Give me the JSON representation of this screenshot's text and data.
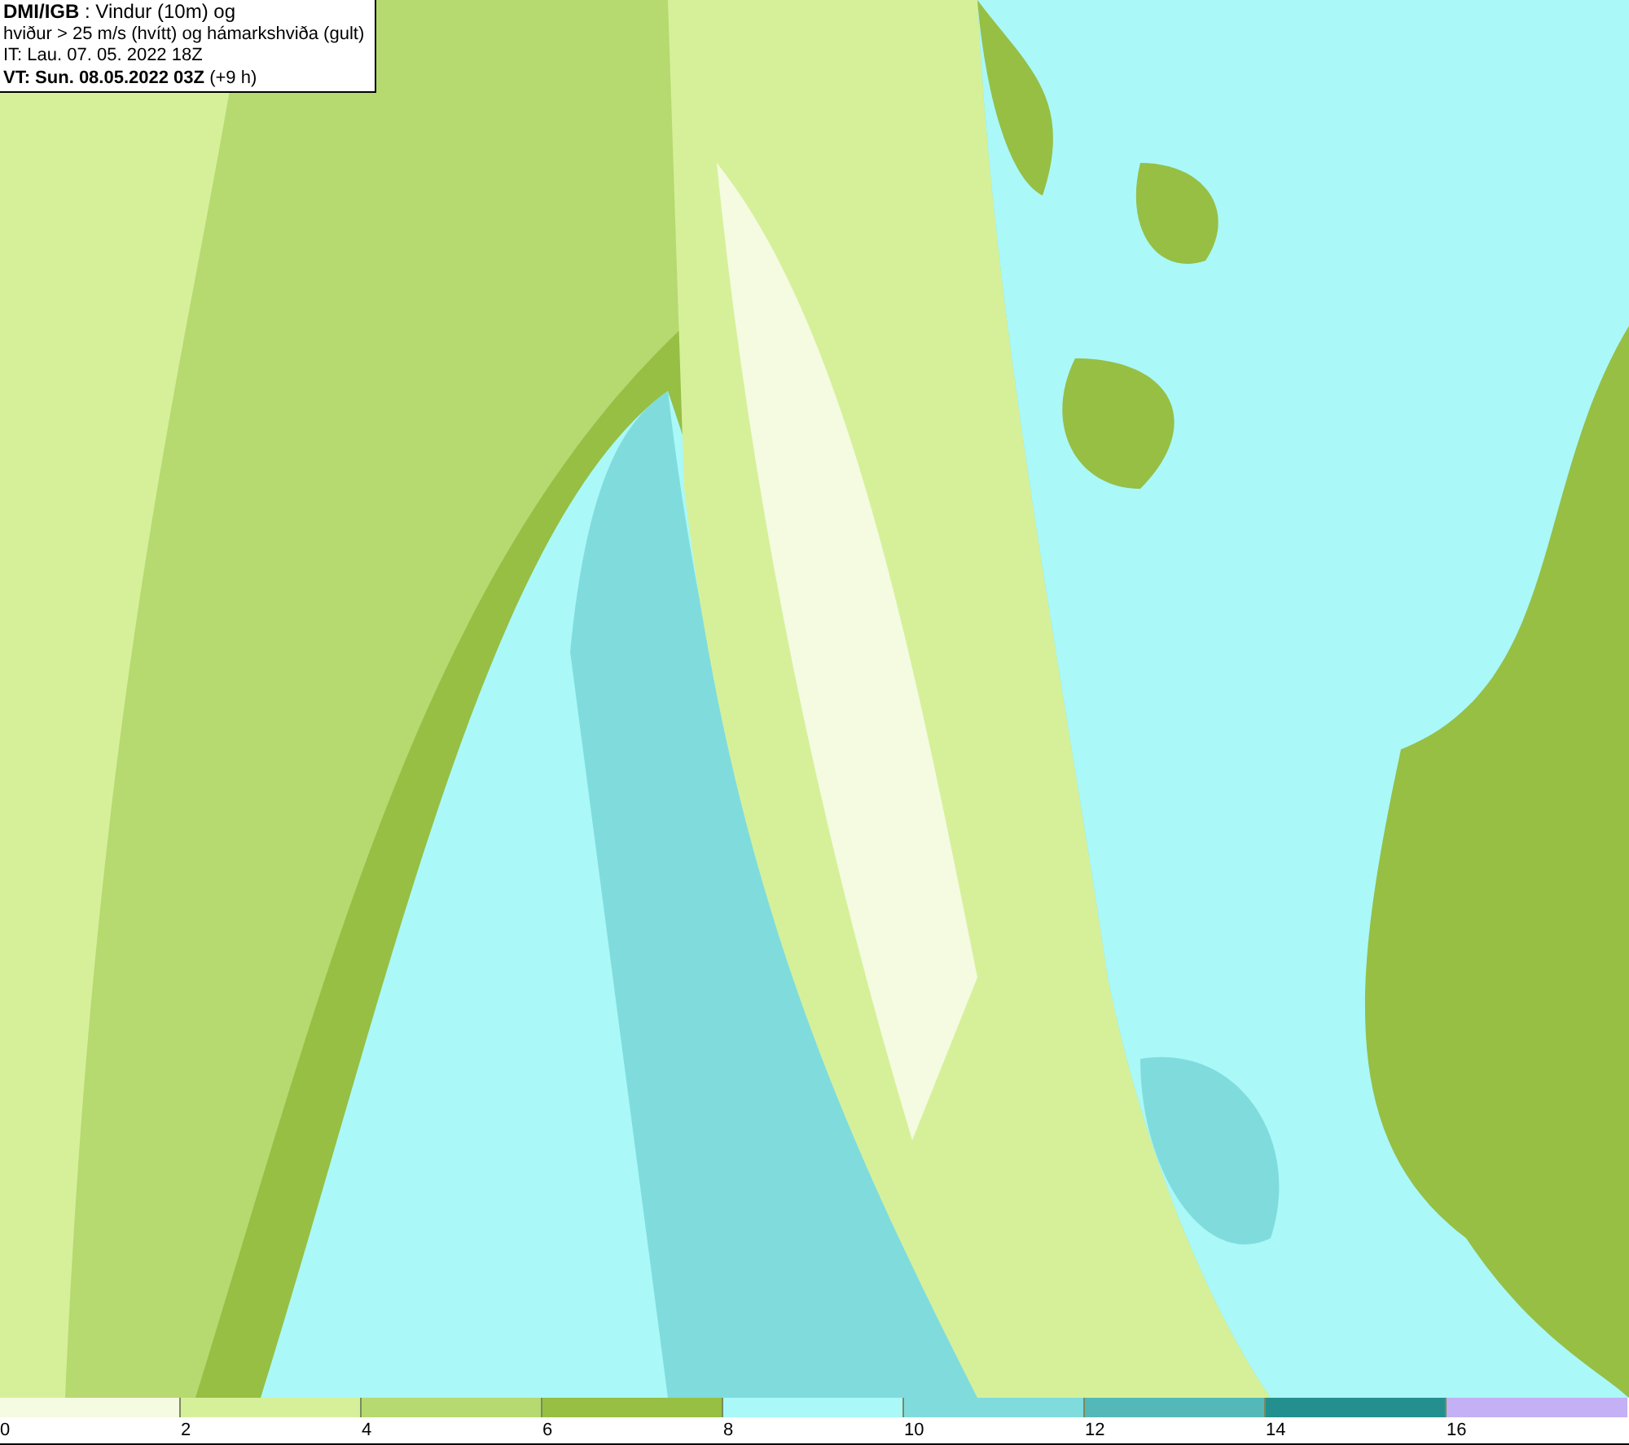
{
  "title_box": {
    "lines": [
      "**DMI/IGB** : Vindur (10m) og",
      "hviður > 25 m/s (hvítt) og hámarkshviða (gult)",
      "IT: Lau. 07. 05. 2022 18Z",
      "**VT: Sun. 08.05.2022 03Z** (+9 h)"
    ]
  },
  "legend": {
    "swatches": [
      {
        "color": "#f4fbe0"
      },
      {
        "color": "#d6f09a"
      },
      {
        "color": "#b6d970"
      },
      {
        "color": "#96bf44"
      },
      {
        "color": "#aaf8f8"
      },
      {
        "color": "#80dcdc"
      },
      {
        "color": "#55b8b8"
      },
      {
        "color": "#248f8f"
      },
      {
        "color": "#c3b0f5"
      }
    ],
    "ticks": [
      "0",
      "2",
      "4",
      "6",
      "8",
      "10",
      "12",
      "14",
      "16"
    ]
  }
}
